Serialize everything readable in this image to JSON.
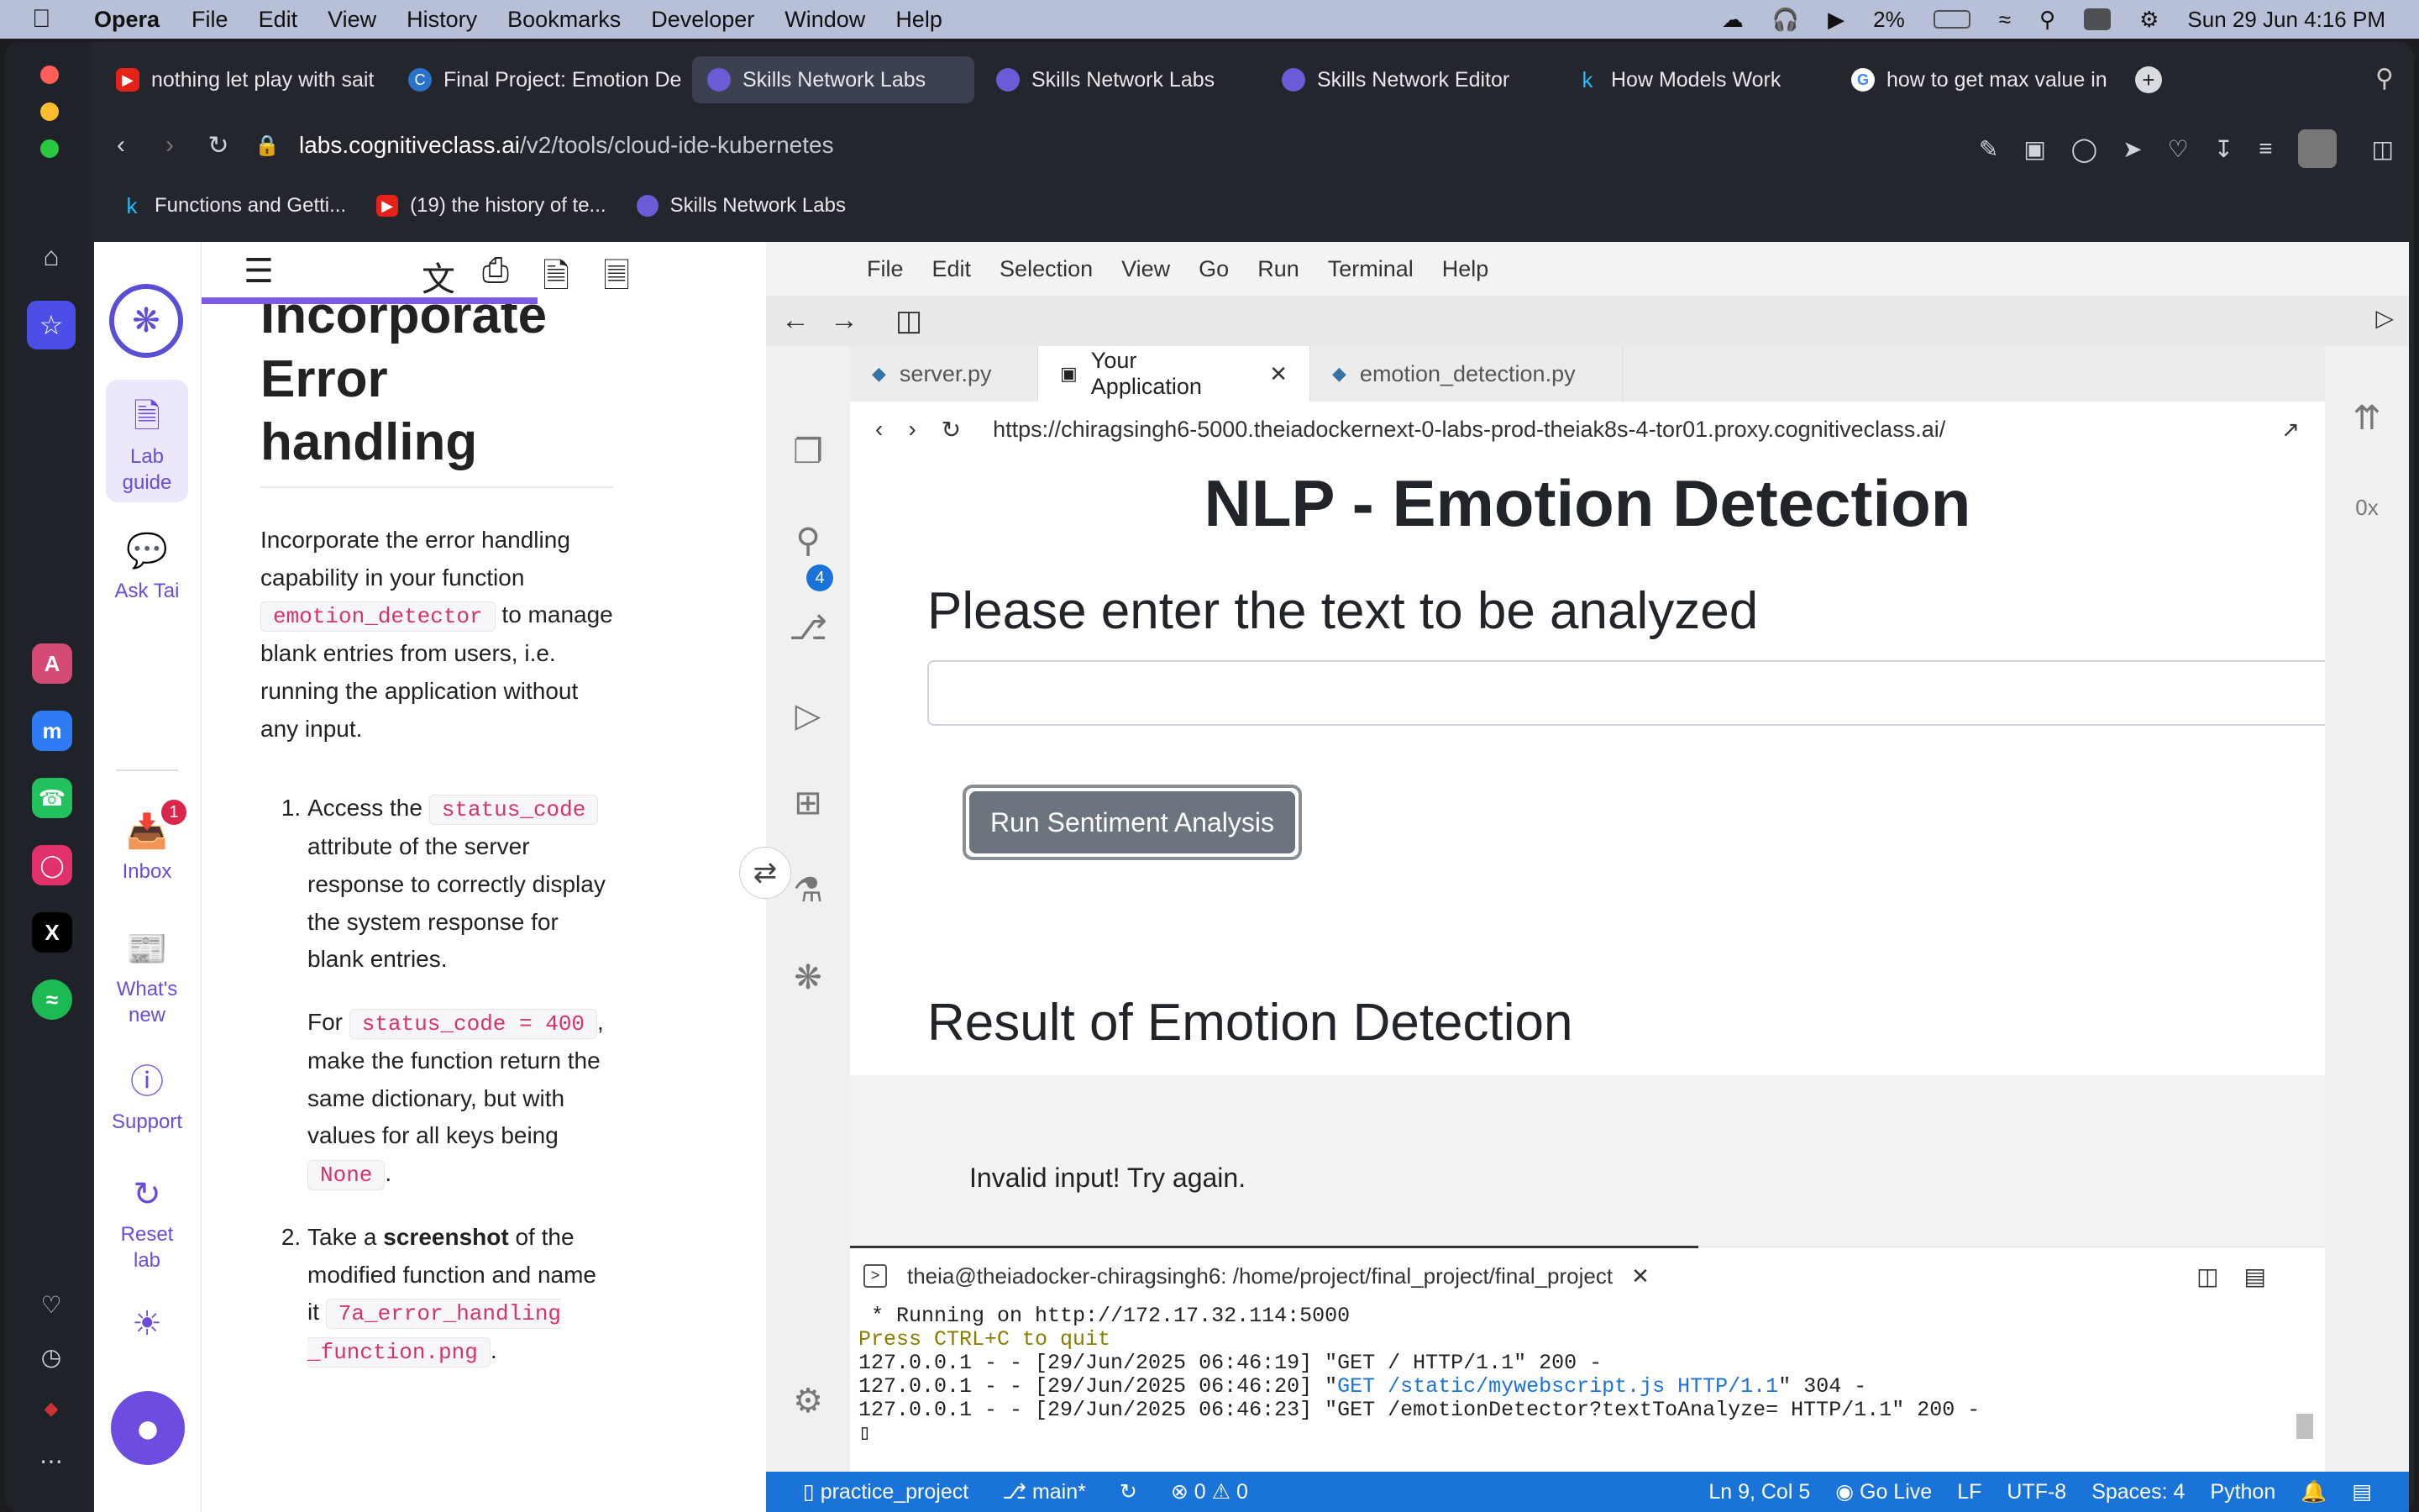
{
  "menubar": {
    "app": "Opera",
    "items": [
      "File",
      "Edit",
      "View",
      "History",
      "Bookmarks",
      "Developer",
      "Window",
      "Help"
    ],
    "battery": "2%",
    "datetime": "Sun 29 Jun  4:16 PM"
  },
  "browser": {
    "tabs": [
      {
        "title": "nothing let play with sait",
        "icon": "youtube-icon",
        "color": "#e62117"
      },
      {
        "title": "Final Project: Emotion De",
        "icon": "coursera-icon",
        "color": "#2a73cc"
      },
      {
        "title": "Skills Network Labs",
        "icon": "skills-network-icon",
        "color": "#5b4ed6"
      },
      {
        "title": "Skills Network Labs",
        "icon": "skills-network-icon",
        "color": "#5b4ed6"
      },
      {
        "title": "Skills Network Editor",
        "icon": "skills-network-icon",
        "color": "#5b4ed6"
      },
      {
        "title": "How Models Work",
        "icon": "kaggle-icon",
        "color": "#20beff"
      },
      {
        "title": "how to get max value in",
        "icon": "google-icon",
        "color": "#ffffff"
      }
    ],
    "url_domain": "labs.cognitiveclass.ai",
    "url_path": "/v2/tools/cloud-ide-kubernetes",
    "bookmarks": [
      {
        "title": "Functions and Getti...",
        "icon": "kaggle-icon"
      },
      {
        "title": "(19) the history of te...",
        "icon": "youtube-icon"
      },
      {
        "title": "Skills Network Labs",
        "icon": "skills-network-icon"
      }
    ]
  },
  "labnav": {
    "lab_guide": "Lab guide",
    "ask_tai": "Ask Tai",
    "inbox": "Inbox",
    "inbox_badge": "1",
    "whats_new": "What's new",
    "support": "Support",
    "reset_lab": "Reset lab"
  },
  "guide": {
    "heading": "Incorporate Error handling",
    "intro_1": "Incorporate the error handling capability in your function ",
    "intro_code": "emotion_detector",
    "intro_2": " to manage blank entries from users, i.e. running the application without any input.",
    "step1_1": "Access the ",
    "step1_code": "status_code",
    "step1_2": " attribute of the server response to correctly display the system response for blank entries.",
    "step1b_1": "For ",
    "step1b_code": "status_code = 400",
    "step1b_2": ", make the function return the same dictionary, but with values for all keys being ",
    "step1b_code2": "None",
    "step1b_3": ".",
    "step2_1": "Take a ",
    "step2_bold": "screenshot",
    "step2_2": " of the modified function and name it ",
    "step2_code": "7a_error_handling _function.png",
    "step2_3": "."
  },
  "ide": {
    "menu": [
      "File",
      "Edit",
      "Selection",
      "View",
      "Go",
      "Run",
      "Terminal",
      "Help"
    ],
    "tabs": [
      {
        "title": "server.py",
        "active": false
      },
      {
        "title": "Your Application",
        "active": true
      },
      {
        "title": "emotion_detection.py",
        "active": false
      }
    ],
    "scm_badge": "4",
    "preview_url": "https://chiragsingh6-5000.theiadockernext-0-labs-prod-theiak8s-4-tor01.proxy.cognitiveclass.ai/",
    "preview": {
      "title": "NLP - Emotion Detection",
      "prompt": "Please enter the text to be analyzed",
      "input_value": "",
      "button": "Run Sentiment Analysis",
      "result_heading": "Result of Emotion Detection",
      "result_text": "Invalid input! Try again."
    },
    "terminal": {
      "title": "theia@theiadocker-chiragsingh6: /home/project/final_project/final_project",
      "line1": " * Running on http://172.17.32.114:5000",
      "line2": "Press CTRL+C to quit",
      "line3": "127.0.0.1 - - [29/Jun/2025 06:46:19] \"GET / HTTP/1.1\" 200 -",
      "line4_a": "127.0.0.1 - - [29/Jun/2025 06:46:20] \"",
      "line4_b": "GET /static/mywebscript.js HTTP/1.1",
      "line4_c": "\" 304 -",
      "line5": "127.0.0.1 - - [29/Jun/2025 06:46:23] \"GET /emotionDetector?textToAnalyze= HTTP/1.1\" 200 -"
    },
    "status": {
      "project": "practice_project",
      "branch": "main*",
      "errors": "0",
      "warnings": "0",
      "position": "Ln 9, Col 5",
      "go_live": "Go Live",
      "eol": "LF",
      "encoding": "UTF-8",
      "spaces": "Spaces: 4",
      "language": "Python"
    }
  },
  "colors": {
    "accent": "#6b4bd8",
    "statusbar": "#1a73d9",
    "button": "#6c757d"
  }
}
